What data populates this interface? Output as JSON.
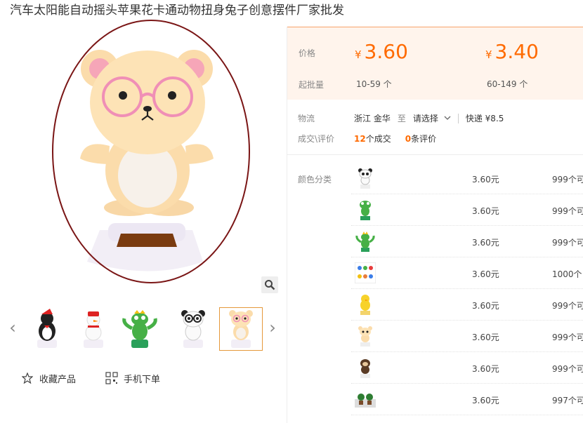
{
  "title": "汽车太阳能自动摇头苹果花卡通动物扭身兔子创意摆件厂家批发",
  "actions": {
    "favorite": "收藏产品",
    "mobile_order": "手机下单"
  },
  "price_box": {
    "price_label": "价格",
    "qty_label": "起批量",
    "currency": "¥",
    "tiers": [
      {
        "price": "3.60",
        "range": "10-59 个"
      },
      {
        "price": "3.40",
        "range": "60-149 个"
      }
    ]
  },
  "logistics": {
    "label": "物流",
    "origin": "浙江 金华",
    "to": "至",
    "select": "请选择",
    "express": "快递 ¥8.5"
  },
  "deals": {
    "label": "成交\\评价",
    "deal_count": "12",
    "deal_suffix": "个成交",
    "review_count": "0",
    "review_suffix": "条评价"
  },
  "sku": {
    "label": "颜色分类",
    "items": [
      {
        "icon": "panda-figure-icon",
        "price": "3.60元",
        "stock": "999个可"
      },
      {
        "icon": "frog-figure-icon",
        "price": "3.60元",
        "stock": "999个可"
      },
      {
        "icon": "frog-crown-figure-icon",
        "price": "3.60元",
        "stock": "999个可"
      },
      {
        "icon": "mixed-figures-icon",
        "price": "3.60元",
        "stock": "1000个"
      },
      {
        "icon": "chick-figure-icon",
        "price": "3.60元",
        "stock": "999个可"
      },
      {
        "icon": "bear-figure-icon",
        "price": "3.60元",
        "stock": "999个可"
      },
      {
        "icon": "monkey-figure-icon",
        "price": "3.60元",
        "stock": "999个可"
      },
      {
        "icon": "flower-pot-figure-icon",
        "price": "3.60元",
        "stock": "997个可"
      }
    ]
  },
  "thumbnails": [
    "penguin-thumbnail",
    "snowman-thumbnail",
    "frog-thumbnail",
    "panda-thumbnail",
    "bear-thumbnail"
  ],
  "colors": {
    "accent": "#ff6a00",
    "price_bg": "#fff4ec",
    "ring": "#7a1515"
  }
}
